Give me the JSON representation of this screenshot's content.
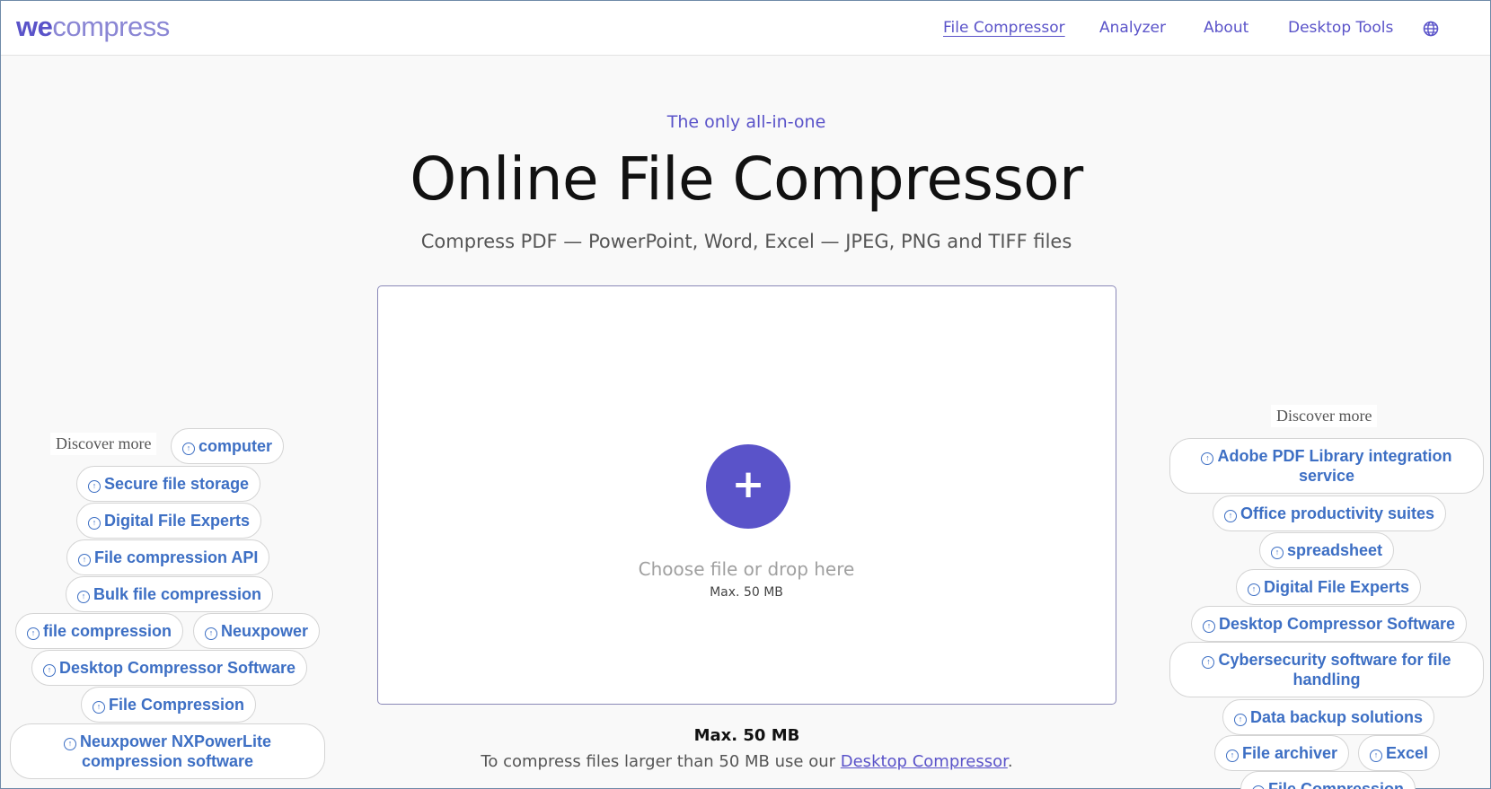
{
  "header": {
    "logo_we": "we",
    "logo_rest": "compress",
    "nav": [
      "File Compressor",
      "Analyzer",
      "About",
      "Desktop Tools"
    ],
    "globe_icon": "globe-icon"
  },
  "hero": {
    "tagline": "The only all-in-one",
    "title": "Online File Compressor",
    "subtitle": "Compress PDF — PowerPoint, Word, Excel — JPEG, PNG and TIFF files"
  },
  "dropzone": {
    "button_label": "+",
    "choose_text": "Choose file or drop here",
    "max_small": "Max. 50 MB"
  },
  "footer_note": {
    "max_bold": "Max. 50 MB",
    "note_prefix": "To compress files larger than 50 MB use our ",
    "link_text": "Desktop Compressor",
    "note_suffix": "."
  },
  "left_discover": {
    "label": "Discover more",
    "chips": [
      "computer",
      "Secure file storage",
      "Digital File Experts",
      "File compression API",
      "Bulk file compression",
      "file compression",
      "Neuxpower",
      "Desktop Compressor Software",
      "File Compression",
      "Neuxpower NXPowerLite compression software"
    ]
  },
  "right_discover": {
    "label": "Discover more",
    "chips": [
      "Adobe PDF Library integration service",
      "Office productivity suites",
      "spreadsheet",
      "Digital File Experts",
      "Desktop Compressor Software",
      "Cybersecurity software for file handling",
      "Data backup solutions",
      "File archiver",
      "Excel",
      "File Compression"
    ]
  },
  "colors": {
    "accent": "#5a53c9",
    "chip_text": "#3d6fc4",
    "background": "#f9f9f9"
  }
}
